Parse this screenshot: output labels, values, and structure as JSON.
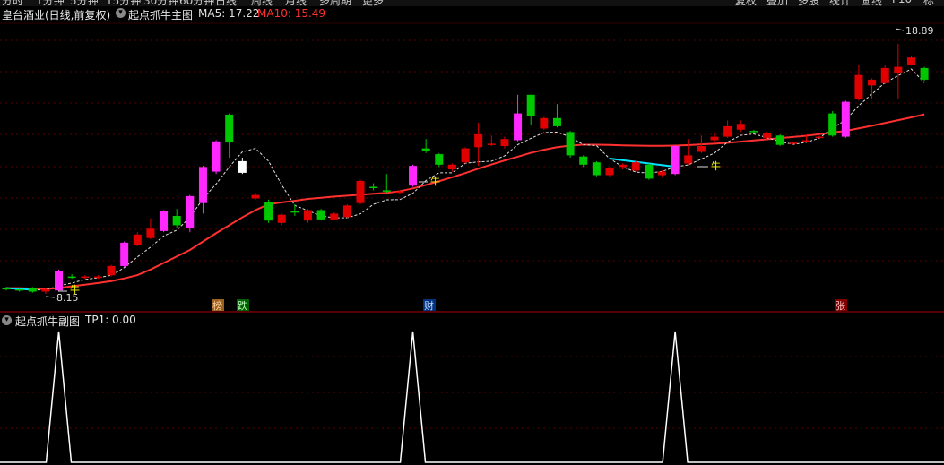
{
  "top_menu": {
    "left_items": [
      "分时",
      "1分钟",
      "5分钟",
      "15分钟",
      "30分钟",
      "60分钟",
      "日线",
      "周线",
      "月线",
      "多周期",
      "更多"
    ],
    "right_items": [
      "复权",
      "叠加",
      "多股",
      "统计",
      "画线",
      "F10",
      "标记"
    ]
  },
  "header": {
    "stock_label": "皇台酒业(日线,前复权)",
    "indicator_name": "起点抓牛主图",
    "ma5": "MA5: 17.22",
    "ma10": "MA10: 15.49",
    "colors": {
      "ma5": "#e0e0e0",
      "ma10": "#ff3030"
    }
  },
  "sub_header": {
    "indicator_name": "起点抓牛副图",
    "tp1": "TP1: 0.00"
  },
  "annotations": {
    "high_label": "18.89",
    "low_label": "8.15",
    "niu_label": "牛",
    "bottom_tags": [
      "榜",
      "跌",
      "财",
      "张"
    ]
  },
  "chart_data": [
    {
      "type": "candlestick",
      "title": "起点抓牛主图",
      "ylim": [
        7.5,
        20.0
      ],
      "candles": [
        {
          "o": 8.35,
          "c": 8.4,
          "h": 8.45,
          "l": 8.3,
          "col": "green"
        },
        {
          "o": 8.3,
          "c": 8.35,
          "h": 8.4,
          "l": 8.25,
          "col": "green"
        },
        {
          "o": 8.4,
          "c": 8.25,
          "h": 8.45,
          "l": 8.2,
          "col": "green"
        },
        {
          "o": 8.25,
          "c": 8.35,
          "h": 8.4,
          "l": 8.15,
          "col": "red"
        },
        {
          "o": 8.3,
          "c": 9.15,
          "h": 9.2,
          "l": 8.25,
          "col": "magenta"
        },
        {
          "o": 8.9,
          "c": 8.85,
          "h": 9.0,
          "l": 8.8,
          "col": "green"
        },
        {
          "o": 8.85,
          "c": 8.9,
          "h": 8.95,
          "l": 8.8,
          "col": "red"
        },
        {
          "o": 8.85,
          "c": 8.9,
          "h": 8.95,
          "l": 8.8,
          "col": "red"
        },
        {
          "o": 8.95,
          "c": 9.35,
          "h": 9.4,
          "l": 8.9,
          "col": "red"
        },
        {
          "o": 9.35,
          "c": 10.35,
          "h": 10.4,
          "l": 9.3,
          "col": "magenta"
        },
        {
          "o": 10.25,
          "c": 10.7,
          "h": 10.8,
          "l": 10.2,
          "col": "red"
        },
        {
          "o": 10.55,
          "c": 10.95,
          "h": 11.4,
          "l": 10.5,
          "col": "red"
        },
        {
          "o": 10.85,
          "c": 11.7,
          "h": 11.75,
          "l": 10.8,
          "col": "magenta"
        },
        {
          "o": 11.5,
          "c": 11.1,
          "h": 11.8,
          "l": 11.0,
          "col": "green"
        },
        {
          "o": 11.0,
          "c": 12.35,
          "h": 12.4,
          "l": 10.8,
          "col": "magenta"
        },
        {
          "o": 12.05,
          "c": 13.6,
          "h": 13.65,
          "l": 11.6,
          "col": "magenta"
        },
        {
          "o": 13.4,
          "c": 14.7,
          "h": 14.75,
          "l": 13.3,
          "col": "magenta"
        },
        {
          "o": 15.85,
          "c": 14.65,
          "h": 15.9,
          "l": 14.0,
          "col": "green"
        },
        {
          "o": 13.85,
          "c": 13.35,
          "h": 14.0,
          "l": 13.3,
          "col": "white"
        },
        {
          "o": 12.4,
          "c": 12.25,
          "h": 12.5,
          "l": 12.2,
          "col": "red"
        },
        {
          "o": 12.1,
          "c": 11.3,
          "h": 12.2,
          "l": 11.2,
          "col": "green"
        },
        {
          "o": 11.55,
          "c": 11.2,
          "h": 11.6,
          "l": 11.1,
          "col": "red"
        },
        {
          "o": 11.7,
          "c": 11.65,
          "h": 12.0,
          "l": 11.5,
          "col": "green"
        },
        {
          "o": 11.75,
          "c": 11.3,
          "h": 11.8,
          "l": 11.2,
          "col": "red"
        },
        {
          "o": 11.75,
          "c": 11.35,
          "h": 11.8,
          "l": 11.3,
          "col": "green"
        },
        {
          "o": 11.6,
          "c": 11.35,
          "h": 11.65,
          "l": 11.3,
          "col": "red"
        },
        {
          "o": 11.45,
          "c": 11.95,
          "h": 12.0,
          "l": 11.4,
          "col": "red"
        },
        {
          "o": 12.05,
          "c": 13.0,
          "h": 13.05,
          "l": 12.0,
          "col": "red"
        },
        {
          "o": 12.7,
          "c": 12.75,
          "h": 12.9,
          "l": 12.6,
          "col": "green"
        },
        {
          "o": 12.55,
          "c": 12.6,
          "h": 13.3,
          "l": 12.5,
          "col": "green"
        },
        {
          "o": 12.55,
          "c": 12.5,
          "h": 12.6,
          "l": 12.45,
          "col": "red"
        },
        {
          "o": 12.8,
          "c": 13.65,
          "h": 13.7,
          "l": 12.75,
          "col": "magenta"
        },
        {
          "o": 14.4,
          "c": 14.3,
          "h": 14.8,
          "l": 14.2,
          "col": "green"
        },
        {
          "o": 14.15,
          "c": 13.7,
          "h": 14.2,
          "l": 13.6,
          "col": "green"
        },
        {
          "o": 13.7,
          "c": 13.5,
          "h": 13.75,
          "l": 13.4,
          "col": "red"
        },
        {
          "o": 13.8,
          "c": 14.4,
          "h": 14.45,
          "l": 13.75,
          "col": "red"
        },
        {
          "o": 14.45,
          "c": 15.0,
          "h": 15.5,
          "l": 13.65,
          "col": "red"
        },
        {
          "o": 14.55,
          "c": 14.6,
          "h": 14.95,
          "l": 14.5,
          "col": "red"
        },
        {
          "o": 14.5,
          "c": 14.8,
          "h": 14.9,
          "l": 14.4,
          "col": "red"
        },
        {
          "o": 14.75,
          "c": 15.9,
          "h": 16.7,
          "l": 14.7,
          "col": "magenta"
        },
        {
          "o": 16.7,
          "c": 15.8,
          "h": 16.7,
          "l": 15.4,
          "col": "green"
        },
        {
          "o": 15.7,
          "c": 15.25,
          "h": 15.75,
          "l": 15.2,
          "col": "red"
        },
        {
          "o": 15.7,
          "c": 15.35,
          "h": 16.3,
          "l": 15.3,
          "col": "green"
        },
        {
          "o": 15.1,
          "c": 14.1,
          "h": 15.15,
          "l": 14.0,
          "col": "green"
        },
        {
          "o": 14.05,
          "c": 13.7,
          "h": 14.1,
          "l": 13.6,
          "col": "green"
        },
        {
          "o": 13.8,
          "c": 13.25,
          "h": 13.85,
          "l": 13.2,
          "col": "green"
        },
        {
          "o": 13.55,
          "c": 13.25,
          "h": 13.6,
          "l": 13.2,
          "col": "red"
        },
        {
          "o": 13.7,
          "c": 13.6,
          "h": 13.75,
          "l": 13.5,
          "col": "red"
        },
        {
          "o": 13.8,
          "c": 13.45,
          "h": 13.85,
          "l": 13.4,
          "col": "red"
        },
        {
          "o": 13.7,
          "c": 13.1,
          "h": 13.75,
          "l": 13.05,
          "col": "green"
        },
        {
          "o": 13.25,
          "c": 13.4,
          "h": 13.45,
          "l": 13.2,
          "col": "red"
        },
        {
          "o": 13.3,
          "c": 14.5,
          "h": 14.55,
          "l": 13.25,
          "col": "magenta"
        },
        {
          "o": 14.1,
          "c": 13.75,
          "h": 14.8,
          "l": 13.7,
          "col": "red"
        },
        {
          "o": 14.25,
          "c": 14.5,
          "h": 14.95,
          "l": 14.2,
          "col": "red"
        },
        {
          "o": 14.75,
          "c": 14.9,
          "h": 15.05,
          "l": 14.7,
          "col": "red"
        },
        {
          "o": 14.9,
          "c": 15.35,
          "h": 15.6,
          "l": 14.85,
          "col": "red"
        },
        {
          "o": 15.45,
          "c": 15.2,
          "h": 15.6,
          "l": 15.1,
          "col": "red"
        },
        {
          "o": 15.1,
          "c": 15.15,
          "h": 15.2,
          "l": 15.05,
          "col": "green"
        },
        {
          "o": 15.05,
          "c": 14.85,
          "h": 15.1,
          "l": 14.8,
          "col": "red"
        },
        {
          "o": 14.95,
          "c": 14.55,
          "h": 15.0,
          "l": 14.5,
          "col": "green"
        },
        {
          "o": 14.65,
          "c": 14.6,
          "h": 14.7,
          "l": 14.55,
          "col": "red"
        },
        {
          "o": 14.75,
          "c": 14.75,
          "h": 15.0,
          "l": 14.7,
          "col": "red"
        },
        {
          "o": 14.85,
          "c": 14.9,
          "h": 14.95,
          "l": 14.8,
          "col": "red"
        },
        {
          "o": 14.95,
          "c": 15.9,
          "h": 16.0,
          "l": 14.9,
          "col": "green"
        },
        {
          "o": 14.9,
          "c": 16.4,
          "h": 16.45,
          "l": 14.85,
          "col": "magenta"
        },
        {
          "o": 16.5,
          "c": 17.55,
          "h": 18.0,
          "l": 16.45,
          "col": "red"
        },
        {
          "o": 17.35,
          "c": 17.1,
          "h": 17.4,
          "l": 16.5,
          "col": "red"
        },
        {
          "o": 17.2,
          "c": 17.85,
          "h": 18.0,
          "l": 17.15,
          "col": "red"
        },
        {
          "o": 17.65,
          "c": 17.9,
          "h": 18.89,
          "l": 16.5,
          "col": "red"
        },
        {
          "o": 18.0,
          "c": 18.3,
          "h": 18.35,
          "l": 17.95,
          "col": "red"
        },
        {
          "o": 17.85,
          "c": 17.35,
          "h": 17.9,
          "l": 17.3,
          "col": "green"
        }
      ],
      "ma5": [
        8.4,
        8.38,
        8.33,
        8.32,
        8.5,
        8.62,
        8.77,
        8.85,
        8.95,
        9.28,
        9.74,
        10.16,
        10.64,
        10.89,
        11.43,
        12.24,
        12.87,
        13.6,
        14.25,
        14.4,
        13.85,
        12.83,
        11.95,
        11.73,
        11.5,
        11.42,
        11.42,
        11.59,
        12.0,
        12.19,
        12.2,
        12.47,
        13.02,
        13.35,
        13.35,
        13.76,
        13.82,
        13.85,
        14.08,
        14.56,
        14.83,
        15.08,
        15.1,
        14.89,
        14.56,
        14.52,
        13.96,
        13.61,
        13.38,
        13.34,
        13.41,
        13.61,
        13.69,
        13.94,
        14.2,
        14.67,
        14.96,
        15.02,
        14.86,
        14.69,
        14.57,
        14.66,
        14.84,
        15.28,
        15.61,
        16.24,
        16.73,
        17.22,
        17.52,
        17.81,
        17.22
      ],
      "ma10": [
        8.4,
        8.4,
        8.38,
        8.36,
        8.4,
        8.48,
        8.55,
        8.62,
        8.7,
        8.82,
        8.96,
        9.2,
        9.48,
        9.76,
        10.04,
        10.4,
        10.76,
        11.1,
        11.44,
        11.75,
        12.0,
        12.08,
        12.15,
        12.23,
        12.28,
        12.33,
        12.37,
        12.41,
        12.45,
        12.49,
        12.56,
        12.68,
        12.83,
        12.99,
        13.16,
        13.34,
        13.53,
        13.71,
        13.88,
        14.04,
        14.21,
        14.34,
        14.45,
        14.52,
        14.56,
        14.56,
        14.55,
        14.53,
        14.52,
        14.51,
        14.51,
        14.52,
        14.54,
        14.57,
        14.6,
        14.64,
        14.69,
        14.74,
        14.79,
        14.84,
        14.89,
        14.94,
        15.01,
        15.08,
        15.15,
        15.26,
        15.37,
        15.49,
        15.61,
        15.73,
        15.86
      ]
    },
    {
      "type": "line",
      "title": "起点抓牛副图",
      "series": [
        {
          "name": "TP1",
          "values": [
            0,
            0,
            0,
            0,
            1,
            0,
            0,
            0,
            0,
            0,
            0,
            0,
            0,
            0,
            0,
            0,
            0,
            0,
            0,
            0,
            0,
            0,
            0,
            0,
            0,
            0,
            0,
            0,
            0,
            0,
            0,
            1,
            0,
            0,
            0,
            0,
            0,
            0,
            0,
            0,
            0,
            0,
            0,
            0,
            0,
            0,
            0,
            0,
            0,
            0,
            0,
            1,
            0,
            0,
            0,
            0,
            0,
            0,
            0,
            0,
            0,
            0,
            0,
            0,
            0,
            0,
            0,
            0,
            0,
            0,
            0
          ]
        }
      ]
    }
  ]
}
